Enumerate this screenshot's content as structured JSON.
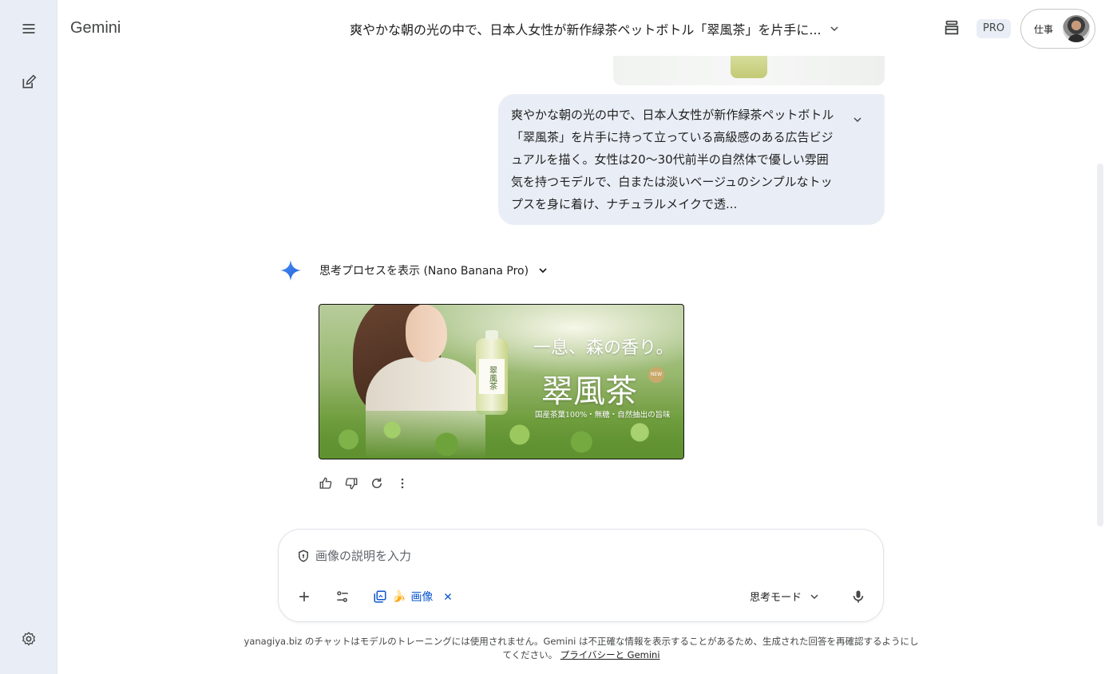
{
  "app": {
    "title": "Gemini"
  },
  "header": {
    "conversation_title": "爽やかな朝の光の中で、日本人女性が新作緑茶ペットボトル「翠風茶」を片手に...",
    "plan_badge": "PRO",
    "account_label": "仕事"
  },
  "user_message": {
    "text": "爽やかな朝の光の中で、日本人女性が新作緑茶ペットボトル「翠風茶」を片手に持って立っている高級感のある広告ビジュアルを描く。女性は20〜30代前半の自然体で優しい雰囲気を持つモデルで、白または淡いベージュのシンプルなトップスを身に着け、ナチュラルメイクで透..."
  },
  "response": {
    "thinking_label": "思考プロセスを表示 (Nano Banana Pro)",
    "image": {
      "headline": "一息、森の香り。",
      "brand": "翠風茶",
      "badge": "NEW",
      "subcopy": "国産茶葉100%・無糖・自然抽出の旨味",
      "bottle_label": "翠風茶"
    }
  },
  "composer": {
    "placeholder": "画像の説明を入力",
    "chip_emoji": "🍌",
    "chip_label": "画像",
    "mode_label": "思考モード"
  },
  "footer": {
    "text": "yanagiya.biz のチャットはモデルのトレーニングには使用されません。Gemini は不正確な情報を表示することがあるため、生成された回答を再確認するようにしてください。",
    "link": "プライバシーと Gemini"
  },
  "colors": {
    "sidebar_bg": "#e9eef6",
    "bubble_bg": "#e9eef6",
    "accent_blue": "#0b57d0"
  }
}
